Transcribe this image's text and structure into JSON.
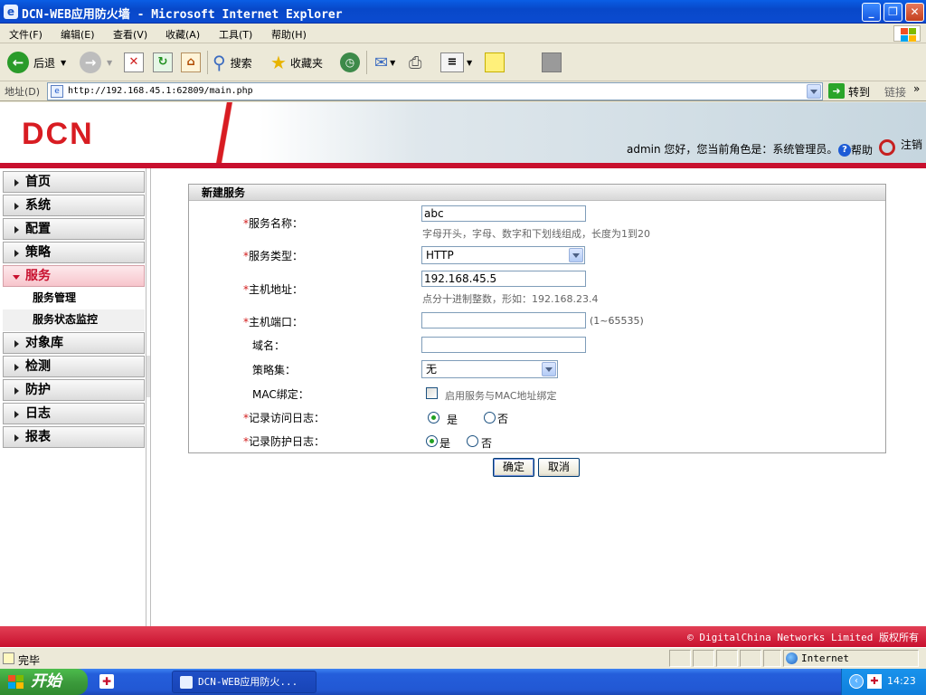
{
  "window": {
    "title": "DCN-WEB应用防火墙 - Microsoft Internet Explorer",
    "minimize": "_",
    "maximize": "❐",
    "close": "✕"
  },
  "menu": [
    "文件(F)",
    "编辑(E)",
    "查看(V)",
    "收藏(A)",
    "工具(T)",
    "帮助(H)"
  ],
  "toolbar": {
    "back": "后退",
    "search": "搜索",
    "favorites": "收藏夹"
  },
  "address": {
    "label": "地址(D)",
    "url": "http://192.168.45.1:62809/main.php",
    "go": "转到",
    "links": "链接"
  },
  "header": {
    "logo": "DCN",
    "user_line": "admin 您好，您当前角色是：系统管理员。",
    "help": "帮助",
    "logout": "注销"
  },
  "sidebar": {
    "items": [
      {
        "label": "首页"
      },
      {
        "label": "系统"
      },
      {
        "label": "配置"
      },
      {
        "label": "策略"
      },
      {
        "label": "服务",
        "open": true
      },
      {
        "label": "对象库"
      },
      {
        "label": "检测"
      },
      {
        "label": "防护"
      },
      {
        "label": "日志"
      },
      {
        "label": "报表"
      }
    ],
    "sub_items": [
      "服务管理",
      "服务状态监控"
    ]
  },
  "form": {
    "title": "新建服务",
    "service_name": {
      "label": "服务名称：",
      "value": "abc",
      "hint": "字母开头，字母、数字和下划线组成，长度为1到20"
    },
    "service_type": {
      "label": "服务类型：",
      "value": "HTTP"
    },
    "host_address": {
      "label": "主机地址：",
      "value": "192.168.45.5",
      "hint": "点分十进制整数，形如：192.168.23.4"
    },
    "host_port": {
      "label": "主机端口：",
      "value": "",
      "hint": "(1~65535)"
    },
    "domain": {
      "label": "域名：",
      "value": ""
    },
    "policy_set": {
      "label": "策略集：",
      "value": "无"
    },
    "mac_bind": {
      "label": "MAC绑定：",
      "checkbox_label": "启用服务与MAC地址绑定"
    },
    "access_log": {
      "label": "记录访问日志：",
      "yes": "是",
      "no": "否"
    },
    "protect_log": {
      "label": "记录防护日志：",
      "yes": "是",
      "no": "否"
    },
    "required_mark": "*",
    "ok": "确定",
    "cancel": "取消"
  },
  "footer": {
    "copyright": "© DigitalChina Networks Limited 版权所有"
  },
  "status": {
    "text": "完毕",
    "zone": "Internet"
  },
  "taskbar": {
    "start": "开始",
    "task": "DCN-WEB应用防火...",
    "clock": "14:23"
  }
}
